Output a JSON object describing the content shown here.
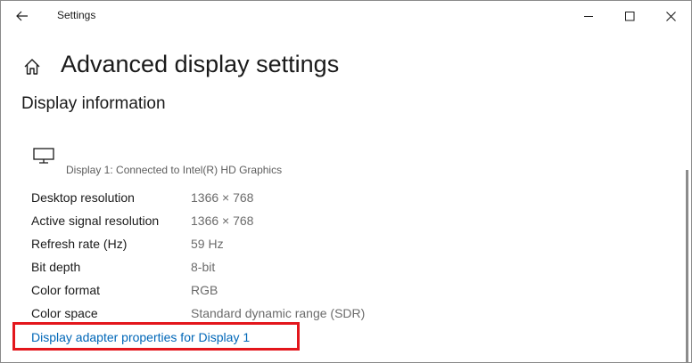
{
  "window": {
    "title": "Settings"
  },
  "icons": {
    "back": "back-arrow-icon",
    "minimize": "minimize-icon",
    "maximize": "maximize-icon",
    "close": "close-icon",
    "home": "home-icon",
    "monitor": "monitor-icon"
  },
  "page": {
    "title": "Advanced display settings",
    "section_title": "Display information",
    "display_caption": "Display 1: Connected to Intel(R) HD Graphics"
  },
  "info": [
    {
      "label": "Desktop resolution",
      "value": "1366 × 768"
    },
    {
      "label": "Active signal resolution",
      "value": "1366 × 768"
    },
    {
      "label": "Refresh rate (Hz)",
      "value": "59 Hz"
    },
    {
      "label": "Bit depth",
      "value": "8-bit"
    },
    {
      "label": "Color format",
      "value": "RGB"
    },
    {
      "label": "Color space",
      "value": "Standard dynamic range (SDR)"
    }
  ],
  "adapter_link": {
    "label": "Display adapter properties for Display 1"
  },
  "colors": {
    "link": "#0067b8",
    "highlight_border": "#e3161c",
    "text_primary": "#1a1a1a",
    "text_secondary": "#6b6b6b"
  }
}
